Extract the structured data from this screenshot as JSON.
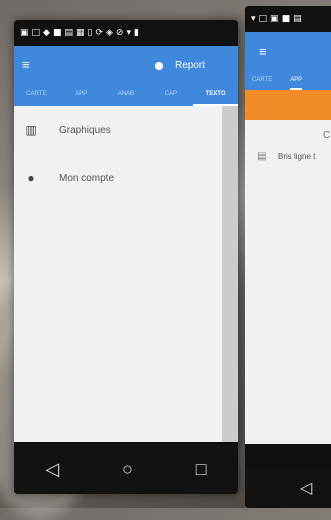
{
  "phone1": {
    "status_icons": [
      "sim-icon",
      "screen-icon",
      "notification-icon",
      "image-icon",
      "tile-icon",
      "gallery-icon",
      "phone-icon",
      "sync-icon",
      "nav-icon",
      "blocked-icon",
      "wifi-icon",
      "battery-icon"
    ],
    "app_bar": {
      "menu": "≡",
      "report_label": "Report"
    },
    "tabs": [
      "CARTE",
      "APP",
      "ANAB",
      "CAP",
      "TEXTO"
    ],
    "active_tab": "TEXTO",
    "drawer_items": [
      {
        "icon": "chart-icon",
        "label": "Graphiques"
      },
      {
        "icon": "comment-icon",
        "label": "Mon compte"
      }
    ],
    "nav": {
      "back": "◁",
      "home": "○",
      "recent": "□"
    }
  },
  "phone2": {
    "status_icons": [
      "wifi-icon",
      "screen-icon",
      "app-icon",
      "image-icon",
      "tile-icon"
    ],
    "app_bar": {
      "menu": "≡"
    },
    "tabs": [
      "CARTE",
      "APP"
    ],
    "active_tab": "APP",
    "content": {
      "c_label": "C",
      "doc_label": "Bris ligne t"
    },
    "nav": {
      "back": "◁"
    }
  },
  "colors": {
    "primary": "#3f88dc",
    "accent": "#f28c28",
    "drawer": "#f1f1f1"
  }
}
